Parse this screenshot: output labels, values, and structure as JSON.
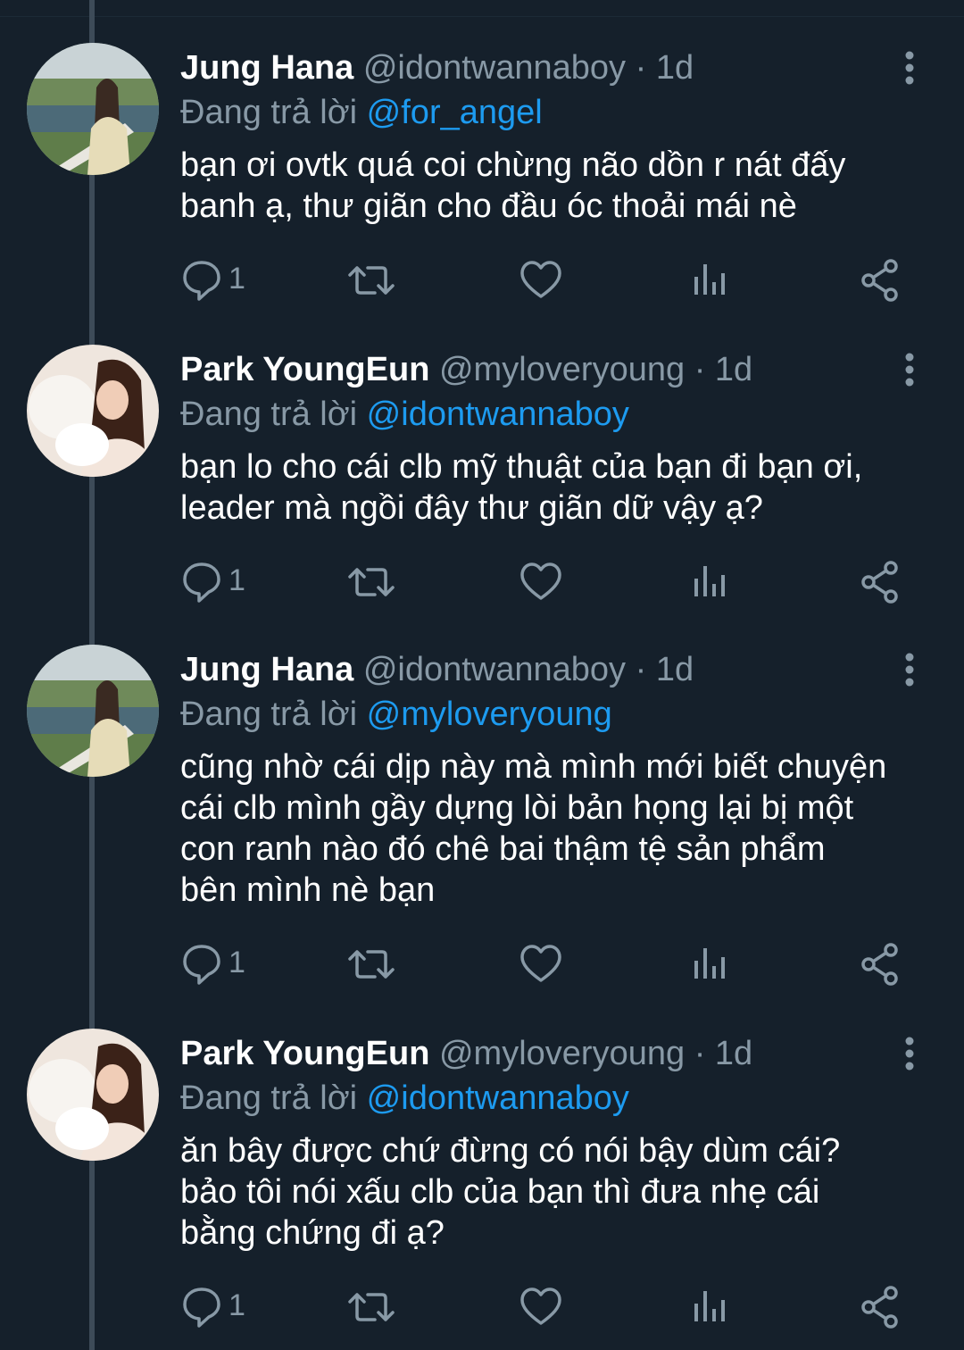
{
  "theme": {
    "background": "#15202b",
    "text": "#ffffff",
    "muted": "#8899a6",
    "accent": "#1d9bf0",
    "thread_line": "#3d4b58"
  },
  "tweets": [
    {
      "name": "Jung Hana",
      "handle": "@idontwannaboy",
      "separator": "·",
      "time": "1d",
      "reply_prefix": "Đang trả lời",
      "reply_to": "@for_angel",
      "text_lines": [
        "bạn ơi ovtk quá coi chừng não dồn r nát đấy",
        "banh ạ, thư giãn cho đầu óc thoải mái nè"
      ],
      "reply_count": "1",
      "avatar": "landscape-portrait"
    },
    {
      "name": "Park YoungEun",
      "handle": "@myloveryoung",
      "separator": "·",
      "time": "1d",
      "reply_prefix": "Đang trả lời",
      "reply_to": "@idontwannaboy",
      "text_lines": [
        "bạn lo cho cái clb mỹ thuật của bạn đi bạn ơi,",
        "leader mà ngồi đây thư giãn dữ vậy ạ?"
      ],
      "reply_count": "1",
      "avatar": "portrait-with-cat"
    },
    {
      "name": "Jung Hana",
      "handle": "@idontwannaboy",
      "separator": "·",
      "time": "1d",
      "reply_prefix": "Đang trả lời",
      "reply_to": "@myloveryoung",
      "text_lines": [
        "cũng nhờ cái dịp này mà mình mới biết chuyện",
        "cái clb mình gầy dựng lòi bản họng lại bị một",
        "con ranh nào đó chê bai thậm tệ sản phẩm",
        "bên mình nè bạn"
      ],
      "reply_count": "1",
      "avatar": "landscape-portrait"
    },
    {
      "name": "Park YoungEun",
      "handle": "@myloveryoung",
      "separator": "·",
      "time": "1d",
      "reply_prefix": "Đang trả lời",
      "reply_to": "@idontwannaboy",
      "text_lines": [
        "ăn bây được chứ đừng có nói bậy dùm cái?",
        "bảo tôi nói xấu clb của bạn thì đưa nhẹ cái",
        "bằng chứng đi ạ?"
      ],
      "reply_count": "1",
      "avatar": "portrait-with-cat"
    }
  ],
  "icons": {
    "more": "more-vertical-icon",
    "reply": "reply-icon",
    "retweet": "retweet-icon",
    "like": "heart-icon",
    "analytics": "analytics-icon",
    "share": "share-icon"
  }
}
